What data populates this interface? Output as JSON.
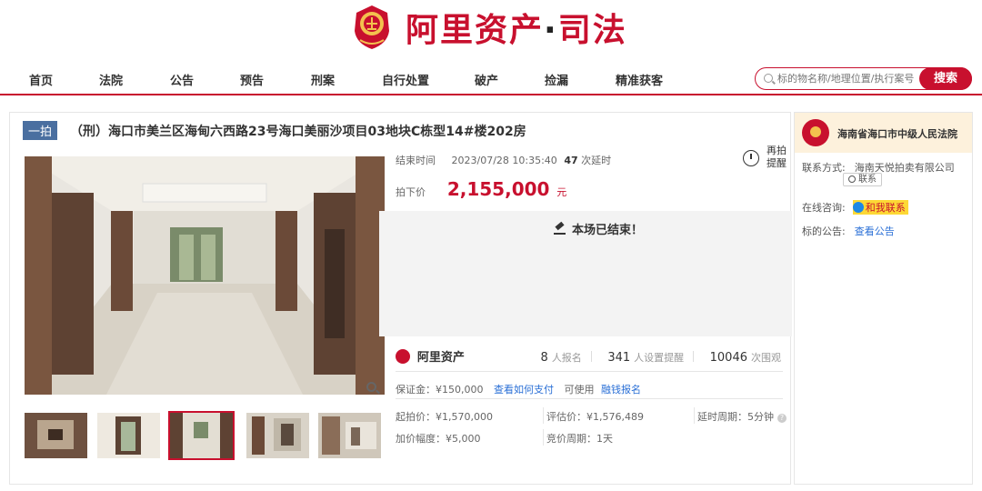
{
  "header": {
    "logo_text": "阿里资产",
    "logo_sep": "·",
    "logo_suffix": "司法",
    "brand_color": "#c8102e",
    "emblem_icon": "court-emblem-icon"
  },
  "nav": {
    "items": [
      "首页",
      "法院",
      "公告",
      "预告",
      "刑案",
      "自行处置",
      "破产",
      "捡漏",
      "精准获客"
    ],
    "search_placeholder": "标的物名称/地理位置/执行案号",
    "search_button": "搜索"
  },
  "auction": {
    "badge": "一拍",
    "title": "（刑）海口市美兰区海甸六西路23号海口美丽沙项目03地块C栋型14#楼202房",
    "end_label": "结束时间",
    "end_time": "2023/07/28 10:35:40",
    "delay_count": "47",
    "delay_label": "次延时",
    "remind_label": "再拍提醒",
    "deal_price_label": "拍下价",
    "deal_price": "2,155,000",
    "deal_price_unit": "元",
    "ended_text": "本场已结束！",
    "brand_name": "阿里资产",
    "stats": {
      "signups": "8",
      "signups_label": "人报名",
      "reminders": "341",
      "reminders_label": "人设置提醒",
      "views": "10046",
      "views_label": "次围观"
    },
    "deposit_text": "保证金：¥150,000",
    "deposit_link": "查看如何支付",
    "deposit_note": "可使用",
    "deposit_link2": "融钱报名",
    "start_price": "起拍价：¥1,570,000",
    "appraisal": "评估价：¥1,576,489",
    "delay_period": "延时周期：5分钟",
    "increment": "加价幅度：¥5,000",
    "bid_period": "竞价周期：1天",
    "thumbnail_count": 5,
    "active_thumbnail": 3
  },
  "side": {
    "court": "海南省海口市中级人民法院",
    "contact_label": "联系方式:",
    "contact_value": "海南天悦拍卖有限公司",
    "contact_button": "联系",
    "consult_label": "在线咨询:",
    "consult_button": "和我联系",
    "notice_label": "标的公告:",
    "notice_link": "查看公告"
  }
}
